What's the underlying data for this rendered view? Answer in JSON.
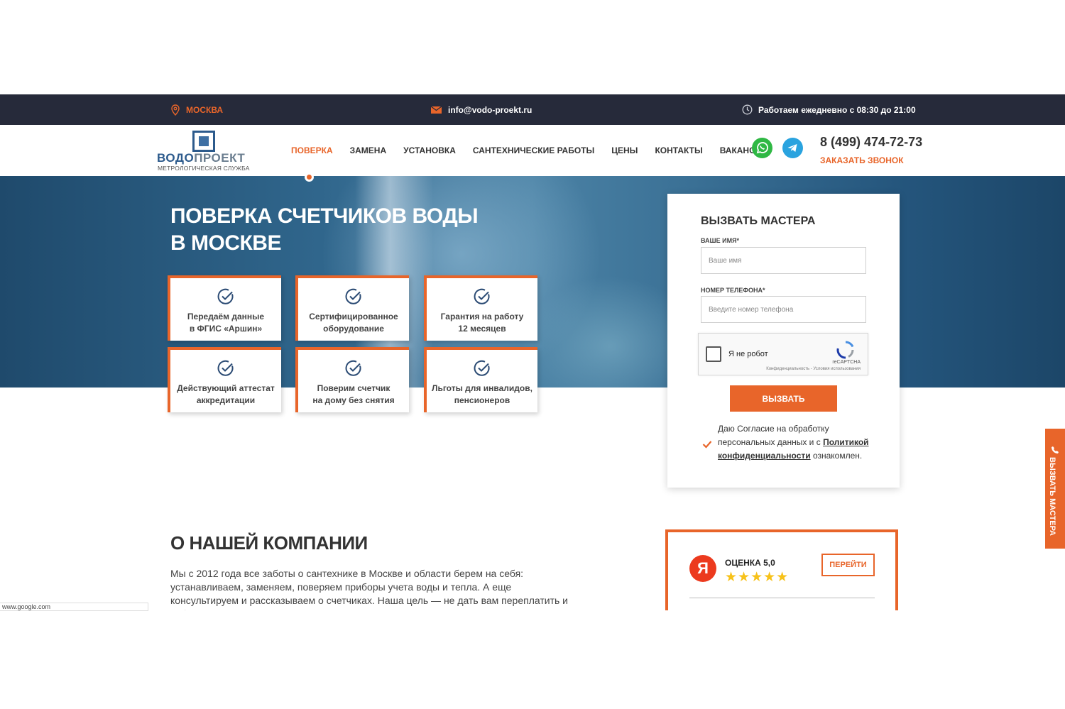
{
  "topbar": {
    "city": "МОСКВА",
    "email": "info@vodo-proekt.ru",
    "hours": "Работаем ежедневно с 08:30 до 21:00"
  },
  "logo": {
    "name_part1": "ВОДО",
    "name_part2": "ПРОЕКТ",
    "subtitle": "МЕТРОЛОГИЧЕСКАЯ СЛУЖБА"
  },
  "nav": {
    "items": [
      {
        "label": "ПОВЕРКА",
        "active": true
      },
      {
        "label": "ЗАМЕНА"
      },
      {
        "label": "УСТАНОВКА"
      },
      {
        "label": "САНТЕХНИЧЕСКИЕ РАБОТЫ"
      },
      {
        "label": "ЦЕНЫ"
      },
      {
        "label": "КОНТАКТЫ"
      },
      {
        "label": "ВАКАНСИИ"
      }
    ]
  },
  "contact": {
    "phone": "8 (499) 474-72-73",
    "callback": "ЗАКАЗАТЬ ЗВОНОК"
  },
  "hero": {
    "title_line1": "ПОВЕРКА СЧЕТЧИКОВ ВОДЫ",
    "title_line2": "В МОСКВЕ",
    "features": [
      {
        "line1": "Передаём данные",
        "line2": "в ФГИС «Аршин»"
      },
      {
        "line1": "Сертифицированное",
        "line2": "оборудование"
      },
      {
        "line1": "Гарантия на работу",
        "line2": "12 месяцев"
      },
      {
        "line1": "Действующий аттестат",
        "line2": "аккредитации"
      },
      {
        "line1": "Поверим счетчик",
        "line2": "на дому без снятия"
      },
      {
        "line1": "Льготы для инвалидов,",
        "line2": "пенсионеров"
      }
    ]
  },
  "form": {
    "title": "ВЫЗВАТЬ МАСТЕРА",
    "name_label": "ВАШЕ ИМЯ*",
    "name_placeholder": "Ваше имя",
    "phone_label": "НОМЕР ТЕЛЕФОНА*",
    "phone_placeholder": "Введите номер телефона",
    "captcha_text": "Я не робот",
    "captcha_brand": "reCAPTCHA",
    "captcha_terms": "Конфиденциальность - Условия использования",
    "submit": "ВЫЗВАТЬ",
    "consent_prefix": "Даю Согласие на обработку персональных данных и с ",
    "consent_link": "Политикой конфиденциальности",
    "consent_suffix": " ознакомлен."
  },
  "side_tab": {
    "label": "ВЫЗВАТЬ МАСТЕРА"
  },
  "about": {
    "title": "О НАШЕЙ КОМПАНИИ",
    "text": "Мы с 2012 года все заботы о сантехнике в Москве и области берем на себя: устанавливаем, заменяем, поверяем приборы учета воды и тепла. А еще консультируем и рассказываем о счетчиках. Наша цель — не дать вам переплатить и избежать протечек и потопов."
  },
  "rating": {
    "logo_letter": "Я",
    "score": "ОЦЕНКА 5,0",
    "stars": "★★★★★",
    "stars_count": 5,
    "go_button": "ПЕРЕЙТИ"
  },
  "statusbar": {
    "text": "www.google.com"
  },
  "colors": {
    "accent": "#e8652a",
    "topbar_bg": "#262a3a",
    "whatsapp": "#2fb844",
    "telegram": "#2aa3df",
    "yandex": "#ec3a1e",
    "stars": "#f7c21a"
  }
}
